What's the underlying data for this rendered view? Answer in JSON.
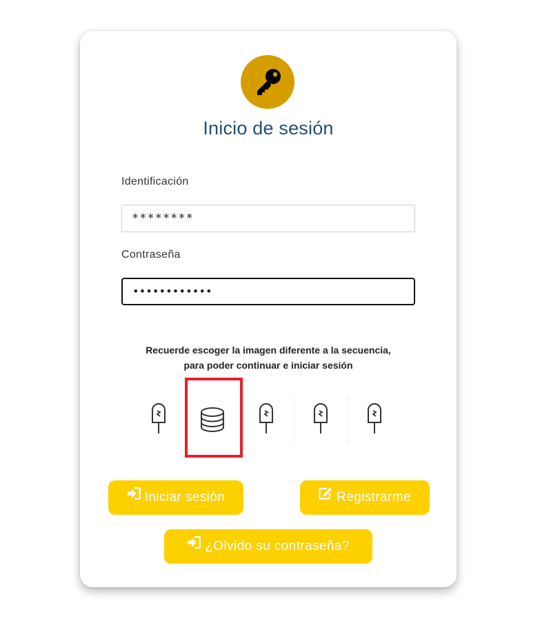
{
  "login": {
    "logo_icon": "key-icon",
    "title": "Inicio de sesión",
    "id_label": "Identificación",
    "id_value": "********",
    "password_label": "Contraseña",
    "password_value": "••••••••••••",
    "captcha_hint_line1": "Recuerde escoger la imagen diferente a la secuencia,",
    "captcha_hint_line2": "para poder continuar e iniciar sesión",
    "captcha_images": [
      {
        "icon": "popsicle-icon",
        "selected": false
      },
      {
        "icon": "coin-stack-icon",
        "selected": true
      },
      {
        "icon": "popsicle-icon",
        "selected": false
      },
      {
        "icon": "popsicle-icon",
        "selected": false
      },
      {
        "icon": "popsicle-icon",
        "selected": false
      }
    ],
    "login_button": "Iniciar sesión",
    "register_button": "Registrarme",
    "forgot_button": "¿Olvido su contraseña?"
  },
  "colors": {
    "brand_yellow": "#fdd000",
    "logo_gold": "#d69d00",
    "title_blue": "#1f4e79",
    "selection_red": "#e3212b"
  }
}
